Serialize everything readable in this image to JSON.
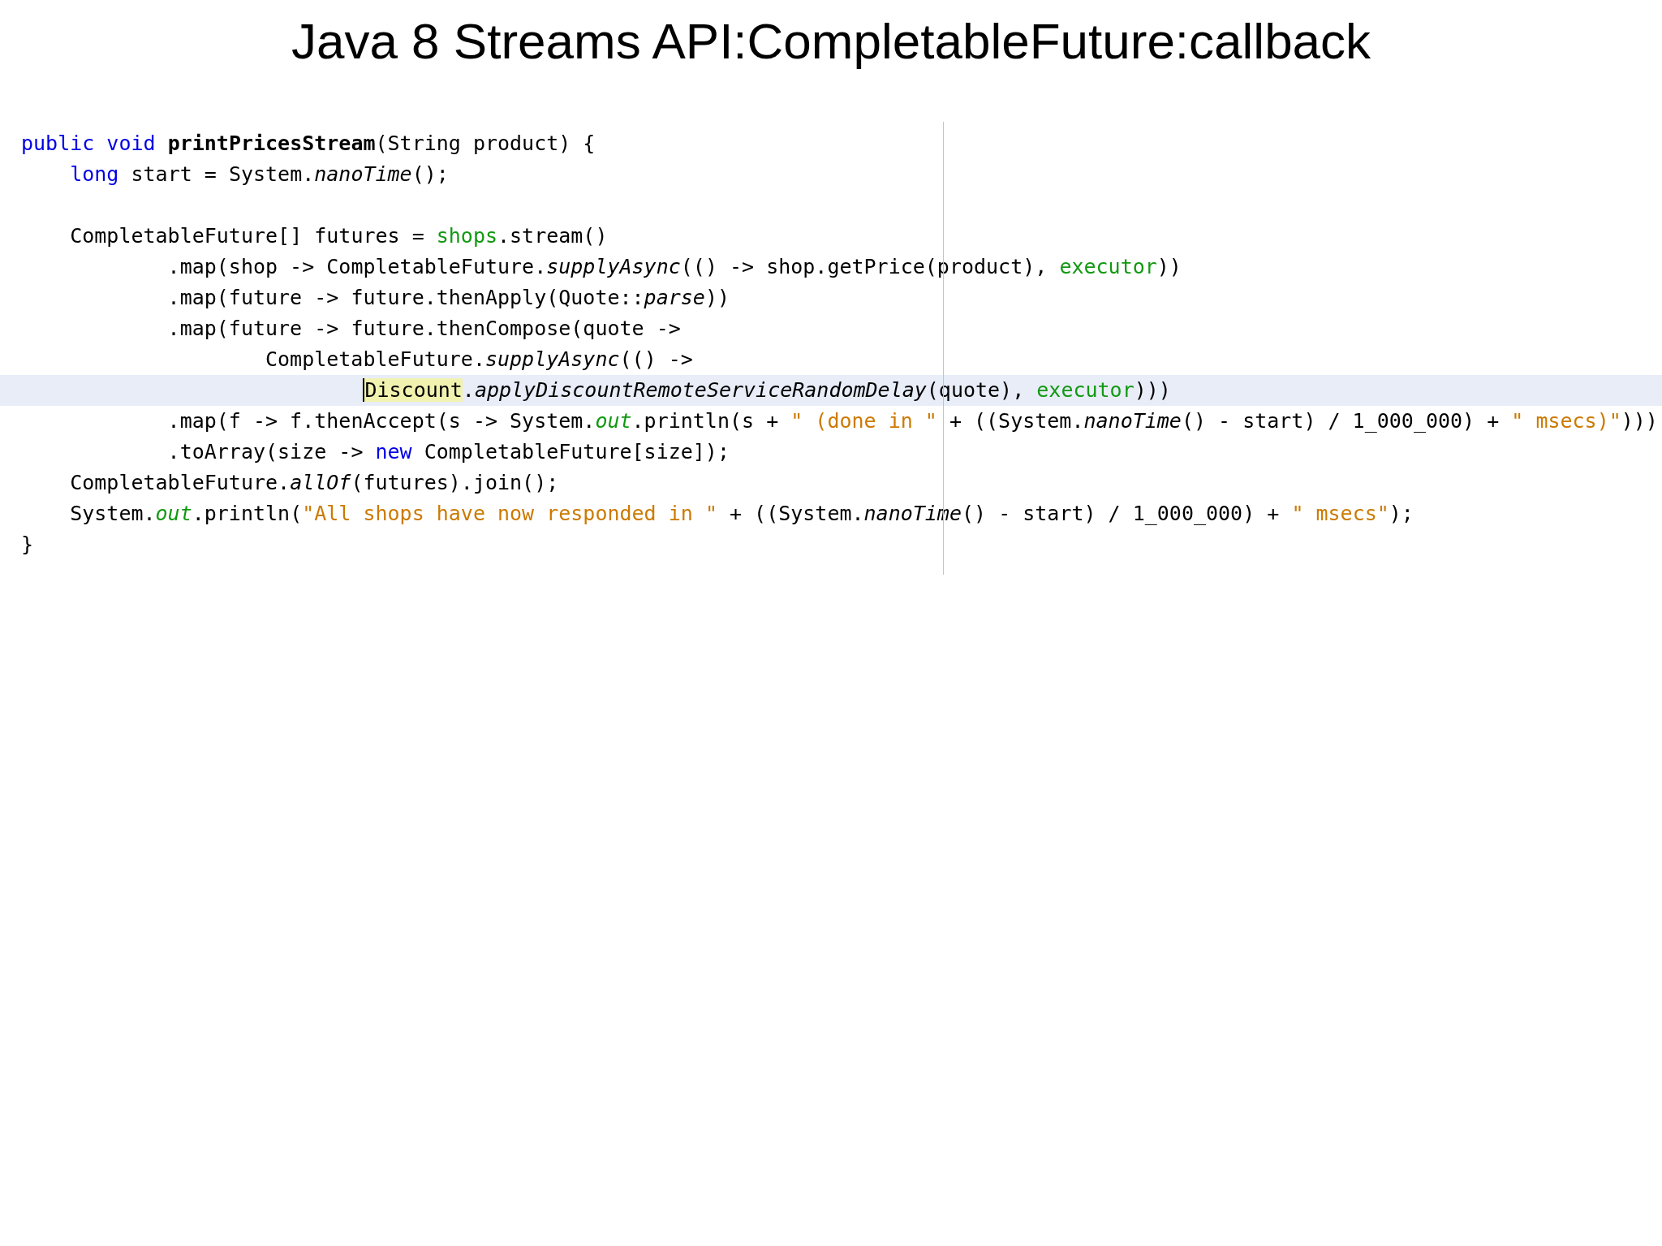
{
  "title": "Java 8 Streams API:CompletableFuture:callback",
  "editor": {
    "lines": [
      {
        "current": false,
        "kind": "none",
        "tokens": [
          {
            "kind": "keyword",
            "text": "public void "
          },
          {
            "kind": "declaration",
            "text": "printPricesStream"
          },
          {
            "kind": "plain",
            "text": "(String product) {"
          }
        ]
      },
      {
        "current": false,
        "kind": "body",
        "tokens": [
          {
            "kind": "keyword",
            "text": "long"
          },
          {
            "kind": "plain",
            "text": " start = System."
          },
          {
            "kind": "static-method",
            "text": "nanoTime"
          },
          {
            "kind": "plain",
            "text": "();"
          }
        ]
      },
      {
        "current": false,
        "kind": "none"
      },
      {
        "current": false,
        "kind": "body",
        "tokens": [
          {
            "kind": "plain",
            "text": "CompletableFuture[] futures = "
          },
          {
            "kind": "field",
            "text": "shops"
          },
          {
            "kind": "plain",
            "text": ".stream()"
          }
        ]
      },
      {
        "current": false,
        "kind": "chain",
        "tokens": [
          {
            "kind": "plain",
            "text": ".map(shop -> CompletableFuture."
          },
          {
            "kind": "static-method",
            "text": "supplyAsync"
          },
          {
            "kind": "plain",
            "text": "(() -> shop.getPrice(product), "
          },
          {
            "kind": "field",
            "text": "executor"
          },
          {
            "kind": "plain",
            "text": "))"
          }
        ]
      },
      {
        "current": false,
        "kind": "chain",
        "tokens": [
          {
            "kind": "plain",
            "text": ".map(future -> future.thenApply(Quote::"
          },
          {
            "kind": "static-method",
            "text": "parse"
          },
          {
            "kind": "plain",
            "text": "))"
          }
        ]
      },
      {
        "current": false,
        "kind": "chain",
        "tokens": [
          {
            "kind": "plain",
            "text": ".map(future -> future.thenCompose(quote ->"
          }
        ]
      },
      {
        "current": false,
        "kind": "inner",
        "tokens": [
          {
            "kind": "plain",
            "text": "CompletableFuture."
          },
          {
            "kind": "static-method",
            "text": "supplyAsync"
          },
          {
            "kind": "plain",
            "text": "(() ->"
          }
        ]
      },
      {
        "current": true,
        "kind": "innermost",
        "tokens": [
          {
            "kind": "match",
            "text": "Discount",
            "caret": true
          },
          {
            "kind": "plain",
            "text": "."
          },
          {
            "kind": "static-method",
            "text": "applyDiscountRemoteServiceRandomDelay"
          },
          {
            "kind": "plain",
            "text": "(quote), "
          },
          {
            "kind": "field",
            "text": "executor"
          },
          {
            "kind": "plain",
            "text": ")))"
          }
        ]
      },
      {
        "current": false,
        "kind": "chain",
        "tokens": [
          {
            "kind": "plain",
            "text": ".map(f -> f.thenAccept(s -> System."
          },
          {
            "kind": "static-field",
            "text": "out"
          },
          {
            "kind": "plain",
            "text": ".println(s + "
          },
          {
            "kind": "string",
            "text": "\" (done in \""
          },
          {
            "kind": "plain",
            "text": " + ((System."
          },
          {
            "kind": "static-method",
            "text": "nanoTime"
          },
          {
            "kind": "plain",
            "text": "() - start) / 1_000_000) + "
          },
          {
            "kind": "string",
            "text": "\" msecs)\""
          },
          {
            "kind": "plain",
            "text": ")))"
          }
        ]
      },
      {
        "current": false,
        "kind": "chain",
        "tokens": [
          {
            "kind": "plain",
            "text": ".toArray(size -> "
          },
          {
            "kind": "keyword",
            "text": "new"
          },
          {
            "kind": "plain",
            "text": " CompletableFuture[size]);"
          }
        ]
      },
      {
        "current": false,
        "kind": "body",
        "tokens": [
          {
            "kind": "plain",
            "text": "CompletableFuture."
          },
          {
            "kind": "static-method",
            "text": "allOf"
          },
          {
            "kind": "plain",
            "text": "(futures).join();"
          }
        ]
      },
      {
        "current": false,
        "kind": "body",
        "tokens": [
          {
            "kind": "plain",
            "text": "System."
          },
          {
            "kind": "static-field",
            "text": "out"
          },
          {
            "kind": "plain",
            "text": ".println("
          },
          {
            "kind": "string",
            "text": "\"All shops have now responded in \""
          },
          {
            "kind": "plain",
            "text": " + ((System."
          },
          {
            "kind": "static-method",
            "text": "nanoTime"
          },
          {
            "kind": "plain",
            "text": "() - start) / 1_000_000) + "
          },
          {
            "kind": "string",
            "text": "\" msecs\""
          },
          {
            "kind": "plain",
            "text": ");"
          }
        ]
      },
      {
        "current": false,
        "kind": "none",
        "tokens": [
          {
            "kind": "plain",
            "text": "}"
          }
        ]
      }
    ]
  }
}
